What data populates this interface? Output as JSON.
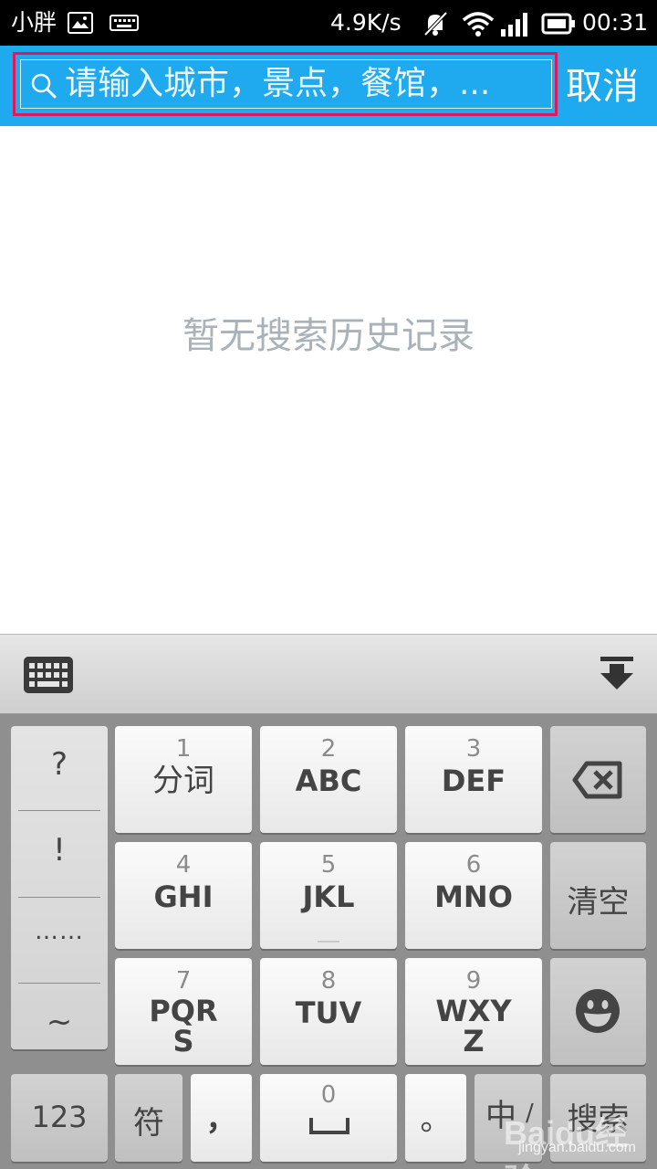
{
  "status_bar": {
    "user": "小胖",
    "speed": "4.9K/s",
    "time": "00:31",
    "icons": [
      "image-icon",
      "keyboard-icon",
      "mute-icon",
      "wifi-icon",
      "signal-icon",
      "battery-icon"
    ]
  },
  "search": {
    "placeholder": "请输入城市，景点，餐馆，...",
    "cancel_label": "取消",
    "highlight_color": "#e0195c",
    "header_color": "#1fa9ee"
  },
  "content": {
    "empty_message": "暂无搜索历史记录"
  },
  "keyboard": {
    "toolbar_icons": [
      "keyboard-switch-icon",
      "hide-keyboard-icon"
    ],
    "punctuation": [
      "?",
      "!",
      "……",
      "~"
    ],
    "keys": [
      {
        "num": "1",
        "label": "分词"
      },
      {
        "num": "2",
        "label": "ABC"
      },
      {
        "num": "3",
        "label": "DEF"
      },
      {
        "num": "4",
        "label": "GHI"
      },
      {
        "num": "5",
        "label": "JKL"
      },
      {
        "num": "6",
        "label": "MNO"
      },
      {
        "num": "7",
        "label": "PQR\nS"
      },
      {
        "num": "8",
        "label": "TUV"
      },
      {
        "num": "9",
        "label": "WXY\nZ"
      }
    ],
    "clear_label": "清空",
    "num_label": "123",
    "symbol_label": "符",
    "comma_label": "，",
    "space_num": "0",
    "period_label": "。",
    "lang_label": "中",
    "lang_sub": "/",
    "search_label": "搜索"
  },
  "watermark": {
    "brand": "Baidu经验",
    "url": "jingyan.baidu.com"
  }
}
